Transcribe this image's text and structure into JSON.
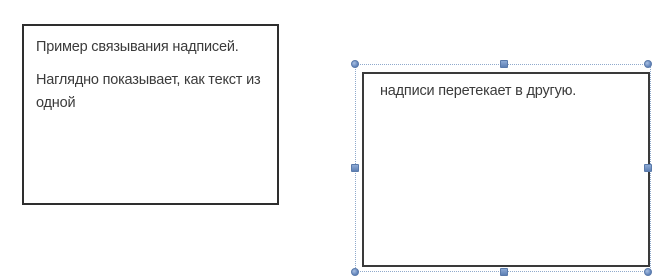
{
  "linked_textboxes": [
    {
      "paragraphs": [
        "Пример связывания надписей.",
        "Наглядно показывает, как текст из одной"
      ]
    },
    {
      "paragraphs": [
        "надписи перетекает в другую."
      ],
      "selected": true
    }
  ],
  "colors": {
    "text": "#3b3b3b",
    "border": "#2e2e2e",
    "selection_handle": "#6f8fbf",
    "selection_outline": "#8fa9cc"
  }
}
